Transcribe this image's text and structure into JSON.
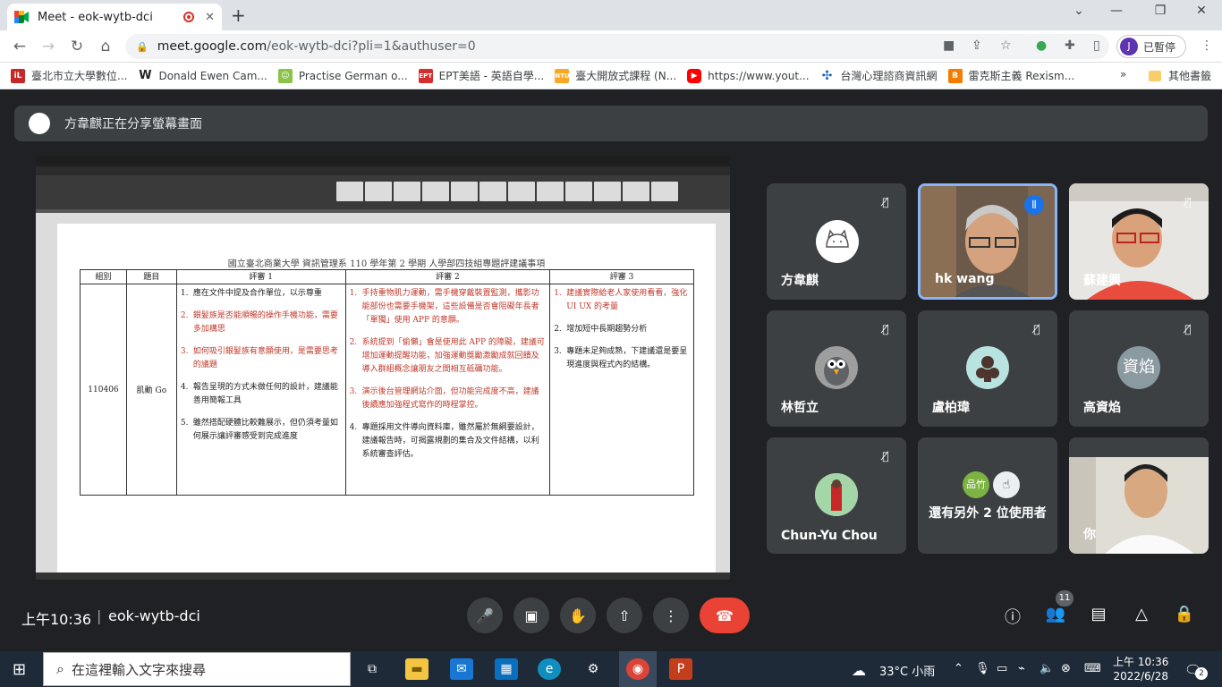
{
  "browser": {
    "tab_title": "Meet - eok-wytb-dci",
    "new_tab": "+",
    "url_domain": "meet.google.com",
    "url_path": "/eok-wytb-dci?pli=1&authuser=0",
    "profile_initial": "J",
    "profile_label": "已暫停",
    "bookmarks": [
      {
        "label": "臺北市立大學數位...",
        "color": "#c62828",
        "icon": "iL"
      },
      {
        "label": "Donald Ewen Cam...",
        "color": "#222222",
        "icon": "W"
      },
      {
        "label": "Practise German o...",
        "color": "#8bc34a",
        "icon": "☺"
      },
      {
        "label": "EPT美語 - 英語自學...",
        "color": "#d32f2f",
        "icon": "EPT"
      },
      {
        "label": "臺大開放式課程 (N...",
        "color": "#f9a825",
        "icon": "NTU"
      },
      {
        "label": "https://www.yout...",
        "color": "#ff0000",
        "icon": "▶"
      },
      {
        "label": "台灣心理諮商資訊網",
        "color": "#1565c0",
        "icon": "✣"
      },
      {
        "label": "雷克斯主義 Rexism...",
        "color": "#f57c00",
        "icon": "B"
      }
    ],
    "bookmarks_more": "»",
    "other_bookmarks": "其他書籤"
  },
  "banner": {
    "text": "方韋麒正在分享螢幕畫面"
  },
  "shared_doc": {
    "title": "國立臺北商業大學  資訊管理系 110 學年第 2 學期  人學部四技組專題評建議事項",
    "headers": [
      "組別",
      "題目",
      "評審 1",
      "評審 2",
      "評審 3"
    ],
    "group": "110406",
    "topic": "肌動 Go",
    "judge1": [
      {
        "n": "1.",
        "text": "應在文件中提及合作單位，以示尊重",
        "red": false
      },
      {
        "n": "2.",
        "text": "銀髮族是否能順暢的操作手機功能，需要多加構思",
        "red": true
      },
      {
        "n": "3.",
        "text": "如何吸引銀髮族有意願使用，是需要思考的議題",
        "red": true
      },
      {
        "n": "4.",
        "text": "報告呈現的方式未做任何的設計，建議能善用簡報工具",
        "red": false
      },
      {
        "n": "5.",
        "text": "雖然搭配硬體比較難展示，但仍須考量如何展示讓評審感受到完成進度",
        "red": false
      }
    ],
    "judge2": [
      {
        "n": "1.",
        "text": "手持重物肌力運動，需手機穿戴裝置監測，攜影功能部份也需要手機架，這些設備是否會阻礙年長者「單獨」使用 APP 的意願。",
        "red": true
      },
      {
        "n": "2.",
        "text": "系統提到「偷懶」會是使用此 APP 的障礙，建議可增加運動提醒功能，加強運動獎勵激勵成就回饋及導入群組概念讓朋友之間相互砥礪功能。",
        "red": true
      },
      {
        "n": "3.",
        "text": "演示後台管理網站介面，但功能完成度不高，建議後續應加強程式寫作的時程掌控。",
        "red": true
      },
      {
        "n": "4.",
        "text": "專題採用文件導向資料庫，雖然屬於無綱要設計，建議報告時，可揭露規劃的集合及文件結構，以利系統審查評估。",
        "red": false
      }
    ],
    "judge3": [
      {
        "n": "1.",
        "text": "建議實際給老人家使用看看，強化 UI UX 的考量",
        "red": true
      },
      {
        "n": "2.",
        "text": "增加短中長期趨勢分析",
        "red": false
      },
      {
        "n": "3.",
        "text": "專題未足夠成熟，下建議還是要呈現進度與程式內的結構。",
        "red": false
      }
    ]
  },
  "participants": [
    {
      "name": "方韋麒",
      "kind": "avatar",
      "muted": true
    },
    {
      "name": "hk wang",
      "kind": "video",
      "speaking": true
    },
    {
      "name": "蘇建興",
      "kind": "video",
      "muted": true
    },
    {
      "name": "林哲立",
      "kind": "avatar",
      "muted": true
    },
    {
      "name": "盧柏瑋",
      "kind": "avatar",
      "muted": true
    },
    {
      "name": "高資焰",
      "kind": "initials",
      "initials": "資焰",
      "muted": true
    },
    {
      "name": "Chun-Yu Chou",
      "kind": "avatar",
      "muted": true
    },
    {
      "name": "還有另外 2 位使用者",
      "kind": "others",
      "initials": "品竹"
    },
    {
      "name": "你",
      "kind": "video"
    }
  ],
  "meeting": {
    "time": "上午10:36",
    "separator": "|",
    "code": "eok-wytb-dci",
    "people_count": "11"
  },
  "taskbar": {
    "search_placeholder": "在這裡輸入文字來搜尋",
    "weather": "33°C 小雨",
    "clock_time": "上午 10:36",
    "clock_date": "2022/6/28",
    "notif_count": "2"
  },
  "colors": {
    "meet_bg": "#202124",
    "tile_bg": "#3c4043",
    "end_call": "#ea4335",
    "speaking_border": "#8ab4f8"
  }
}
